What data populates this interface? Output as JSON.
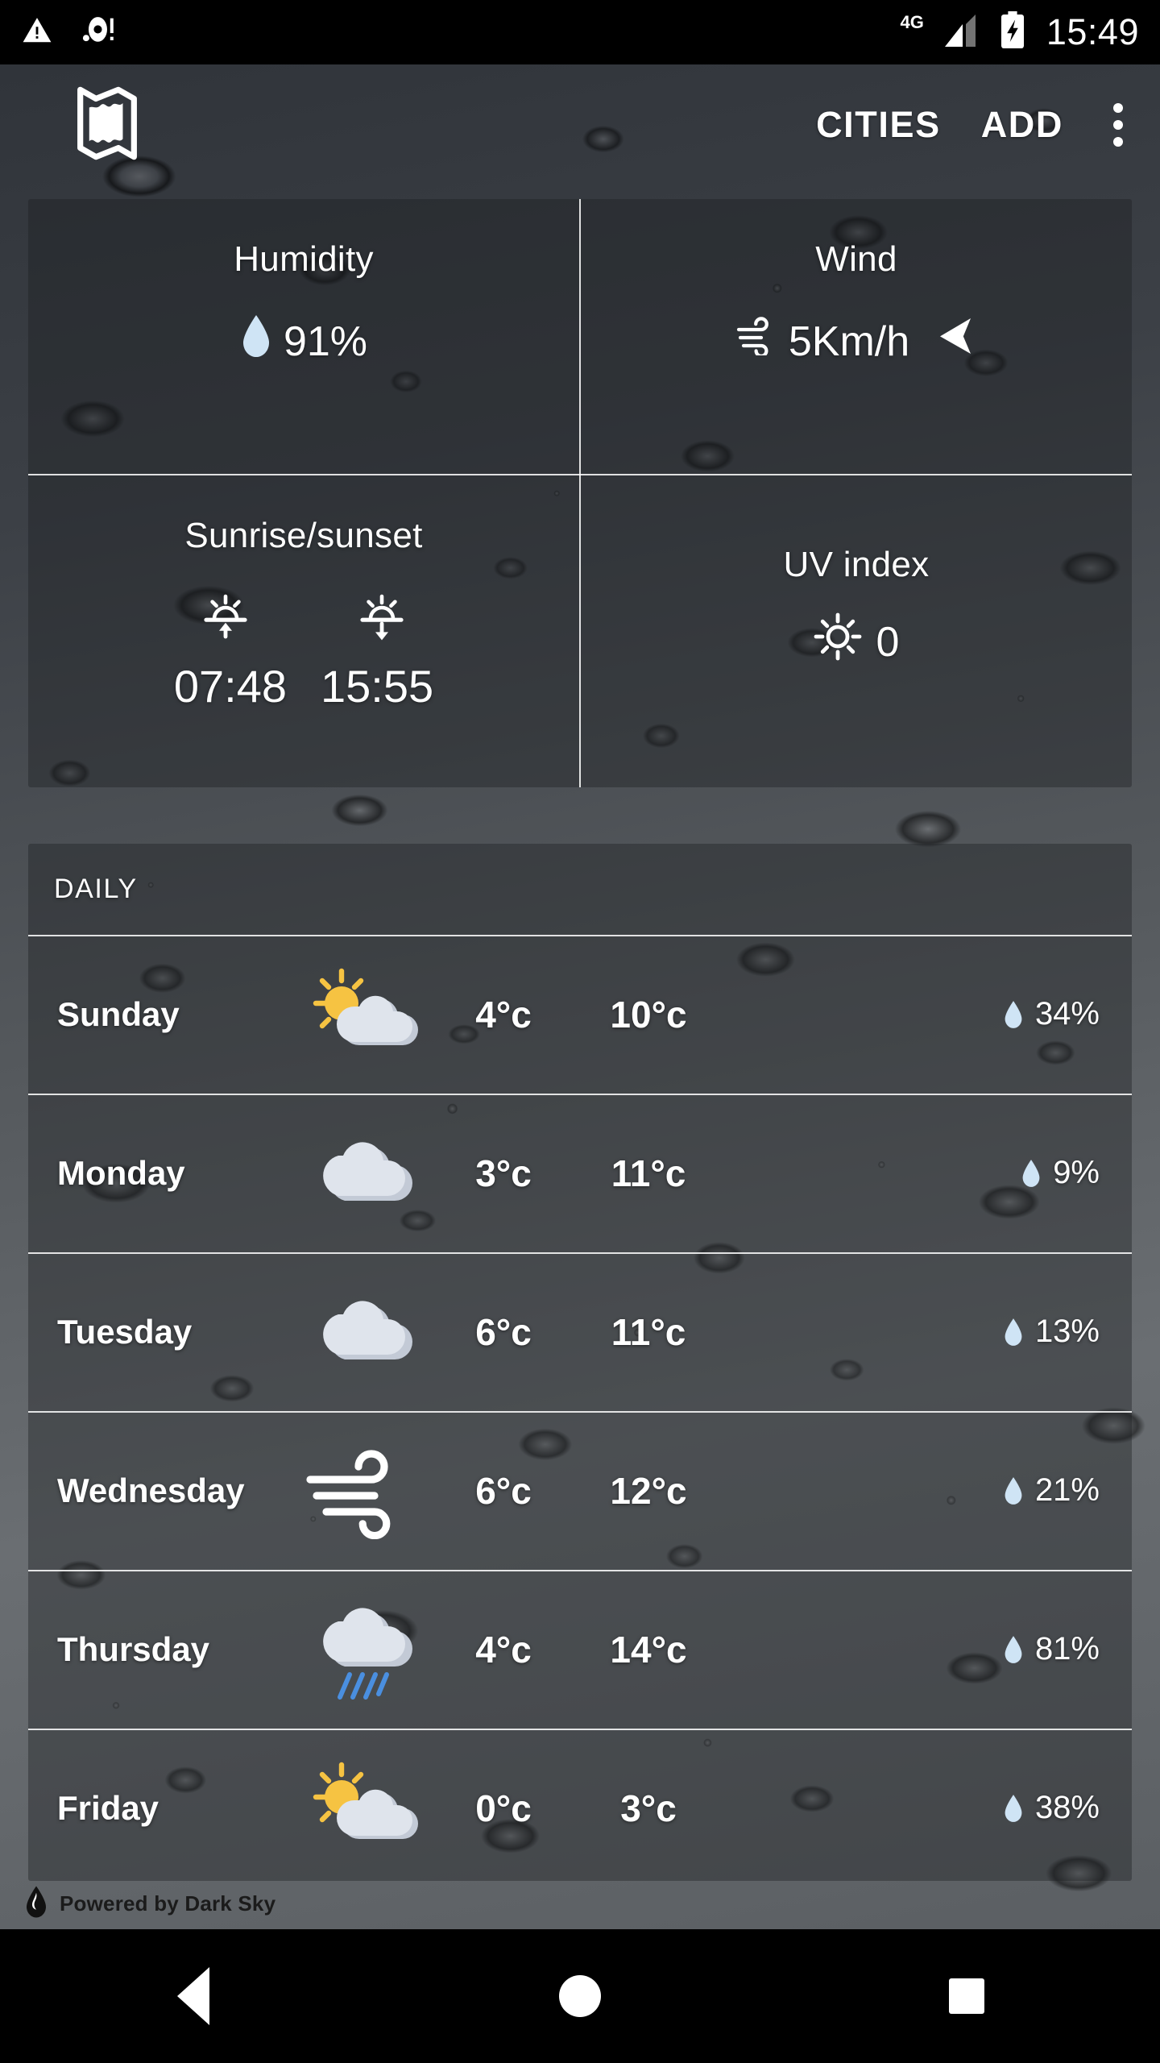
{
  "status_bar": {
    "icons": [
      "warning-triangle-icon",
      "rec-dot-icon"
    ],
    "network_label": "4G",
    "signal_icon": "signal-bars-icon",
    "battery_icon": "battery-charging-icon",
    "time": "15:49"
  },
  "app_bar": {
    "map_icon": "map-icon",
    "cities_label": "CITIES",
    "add_label": "ADD",
    "overflow_icon": "overflow-menu-icon"
  },
  "current": {
    "humidity": {
      "title": "Humidity",
      "icon": "water-drop-icon",
      "value": "91%"
    },
    "wind": {
      "title": "Wind",
      "icon": "wind-icon",
      "value": "5Km/h",
      "direction_icon": "wind-direction-arrow-icon"
    },
    "sun": {
      "title": "Sunrise/sunset",
      "sunrise_icon": "sunrise-icon",
      "sunset_icon": "sunset-icon",
      "sunrise": "07:48",
      "sunset": "15:55"
    },
    "uv": {
      "title": "UV index",
      "icon": "sun-icon",
      "value": "0"
    }
  },
  "daily": {
    "header": "DAILY",
    "rows": [
      {
        "day": "Sunday",
        "icon": "partly-cloudy-icon",
        "low": "4°c",
        "high": "10°c",
        "pop": "34%"
      },
      {
        "day": "Monday",
        "icon": "cloudy-icon",
        "low": "3°c",
        "high": "11°c",
        "pop": "9%"
      },
      {
        "day": "Tuesday",
        "icon": "cloudy-icon",
        "low": "6°c",
        "high": "11°c",
        "pop": "13%"
      },
      {
        "day": "Wednesday",
        "icon": "windy-icon",
        "low": "6°c",
        "high": "12°c",
        "pop": "21%"
      },
      {
        "day": "Thursday",
        "icon": "rain-icon",
        "low": "4°c",
        "high": "14°c",
        "pop": "81%"
      },
      {
        "day": "Friday",
        "icon": "partly-cloudy-icon",
        "low": "0°c",
        "high": "3°c",
        "pop": "38%"
      }
    ]
  },
  "footer": {
    "logo_icon": "dark-sky-logo-icon",
    "credit": "Powered by Dark Sky"
  },
  "nav_bar": {
    "back_icon": "back-triangle-icon",
    "home_icon": "home-circle-icon",
    "recents_icon": "recents-square-icon"
  },
  "colors": {
    "accent_drop": "#cfe4f5",
    "sun_yellow": "#f6c342",
    "cloud_light": "#dfe4ec",
    "cloud_shadow": "#c3cad6",
    "rain_blue": "#4a8fe0",
    "panel_overlay": "#1a1c1f"
  }
}
